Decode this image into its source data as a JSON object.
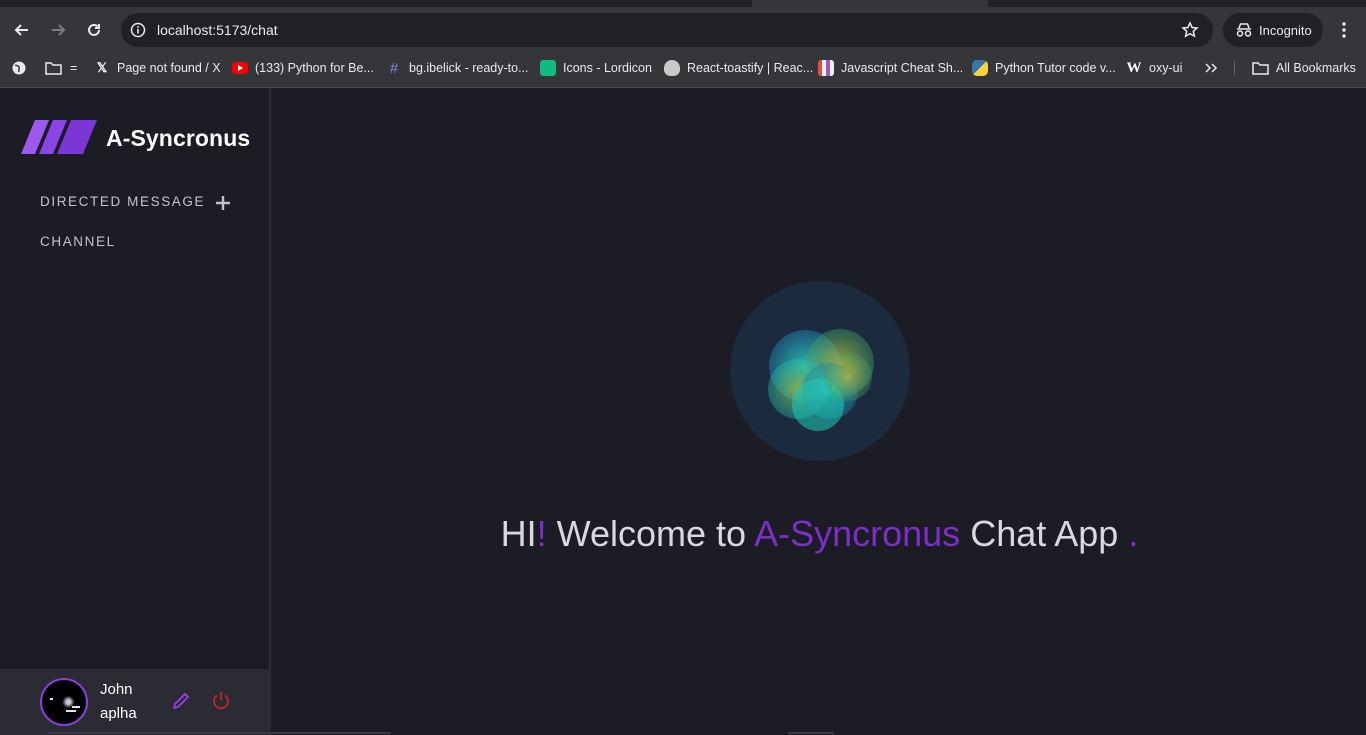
{
  "browser": {
    "url": "localhost:5173/chat",
    "incognito_label": "Incognito",
    "bookmarks": [
      {
        "label": "Page not found / X",
        "icon": "x-logo-icon"
      },
      {
        "label": "(133) Python for Be...",
        "icon": "youtube-icon"
      },
      {
        "label": "bg.ibelick - ready-to...",
        "icon": "hash-icon"
      },
      {
        "label": "Icons - Lordicon",
        "icon": "lordicon-icon"
      },
      {
        "label": "React-toastify | Reac...",
        "icon": "toastify-icon"
      },
      {
        "label": "Javascript Cheat Sh...",
        "icon": "cheatsheet-icon"
      },
      {
        "label": "Python Tutor code v...",
        "icon": "python-icon"
      },
      {
        "label": "oxy-ui",
        "icon": "wiki-icon"
      }
    ],
    "folder_label": "=",
    "all_bookmarks_label": "All Bookmarks"
  },
  "app": {
    "name": "A-Syncronus",
    "sections": {
      "directed_message": "DIRECTED MESSAGE",
      "channel": "CHANNEL"
    },
    "user": {
      "first_name": "John",
      "last_name": "aplha"
    },
    "welcome": {
      "hi": "HI",
      "bang": "!",
      "welcome_to": "Welcome to",
      "app_name": "A-Syncronus",
      "chat_app": "Chat App",
      "dot": "."
    }
  },
  "colors": {
    "accent": "#7c2fc8",
    "background": "#1c1c24",
    "power": "#c0262d"
  }
}
